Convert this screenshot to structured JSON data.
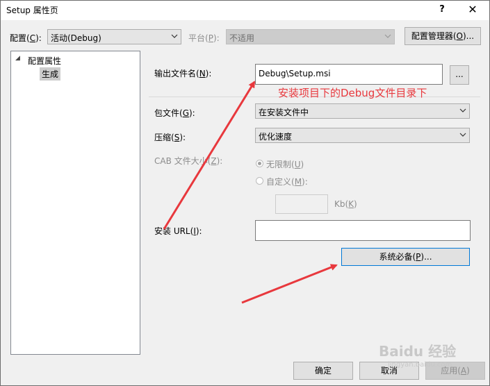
{
  "window": {
    "title": "Setup 属性页",
    "help_label": "?",
    "close_label": "✕"
  },
  "config_bar": {
    "config_label": "配置(",
    "config_key": "C",
    "config_label_end": "):",
    "config_value": "活动(Debug)",
    "platform_label": "平台(",
    "platform_key": "P",
    "platform_label_end": "):",
    "platform_value": "不适用",
    "config_manager_label": "配置管理器(",
    "config_manager_key": "O",
    "config_manager_label_end": ")..."
  },
  "tree": {
    "root_toggle": "◢",
    "root_label": "配置属性",
    "child_label": "生成"
  },
  "form": {
    "output_label": "输出文件名(",
    "output_key": "N",
    "output_label_end": "):",
    "output_value": "Debug\\Setup.msi",
    "browse_label": "...",
    "package_label": "包文件(",
    "package_key": "G",
    "package_label_end": "):",
    "package_value": "在安装文件中",
    "compress_label": "压缩(",
    "compress_key": "S",
    "compress_label_end": "):",
    "compress_value": "优化速度",
    "cab_label": "CAB 文件大小(",
    "cab_key": "Z",
    "cab_label_end": "):",
    "unlimited_label": "无限制(",
    "unlimited_key": "U",
    "unlimited_label_end": ")",
    "custom_label": "自定义(",
    "custom_key": "M",
    "custom_label_end": "):",
    "kb_label": "Kb(",
    "kb_key": "K",
    "kb_label_end": ")",
    "install_url_label": "安装 URL(",
    "install_url_key": "I",
    "install_url_label_end": "):",
    "install_url_value": "",
    "prereq_label": "系统必备(",
    "prereq_key": "P",
    "prereq_label_end": ")..."
  },
  "footer": {
    "ok_label": "确定",
    "cancel_label": "取消",
    "apply_label": "应用(",
    "apply_key": "A",
    "apply_label_end": ")"
  },
  "annotation": {
    "text": "安装项目下的Debug文件目录下",
    "color": "#e8383d"
  },
  "watermark": {
    "brand": "Baidu 经验",
    "site": "jingyan.baidu.com"
  }
}
